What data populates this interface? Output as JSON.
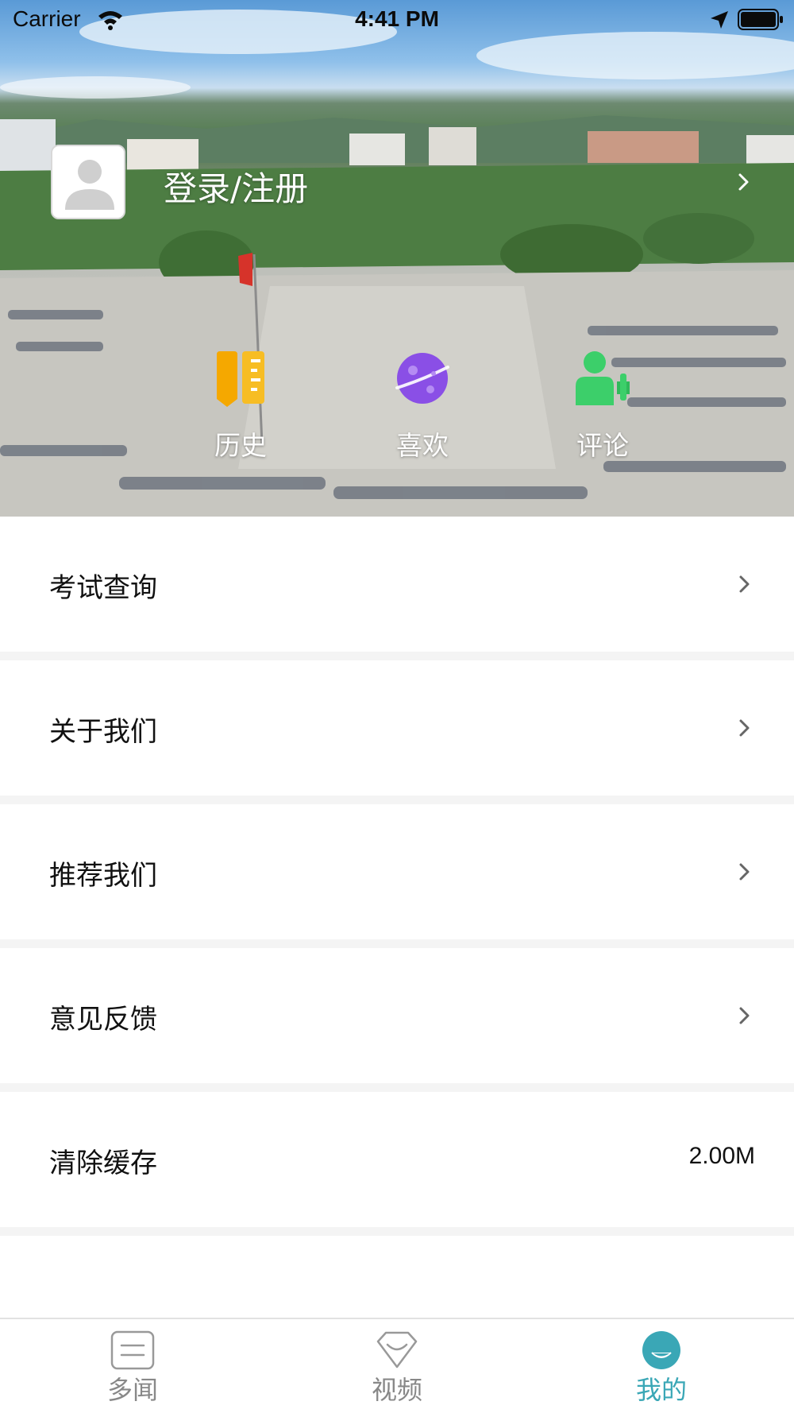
{
  "status_bar": {
    "carrier": "Carrier",
    "time": "4:41 PM"
  },
  "profile": {
    "login_label": "登录/注册"
  },
  "shortcuts": [
    {
      "label": "历史",
      "icon": "history-book-icon",
      "color": "#f5b400"
    },
    {
      "label": "喜欢",
      "icon": "planet-like-icon",
      "color": "#8a4fe6"
    },
    {
      "label": "评论",
      "icon": "comment-person-icon",
      "color": "#3ccf6a"
    }
  ],
  "menu": {
    "items": [
      {
        "label": "考试查询",
        "has_arrow": true
      },
      {
        "label": "关于我们",
        "has_arrow": true
      },
      {
        "label": "推荐我们",
        "has_arrow": true
      },
      {
        "label": "意见反馈",
        "has_arrow": true
      },
      {
        "label": "清除缓存",
        "value": "2.00M"
      }
    ]
  },
  "tabbar": {
    "tabs": [
      {
        "label": "多闻",
        "icon": "news-list-icon",
        "active": false
      },
      {
        "label": "视频",
        "icon": "video-heart-icon",
        "active": false
      },
      {
        "label": "我的",
        "icon": "profile-face-icon",
        "active": true
      }
    ],
    "active_color": "#3aa7b6",
    "inactive_color": "#888888"
  }
}
